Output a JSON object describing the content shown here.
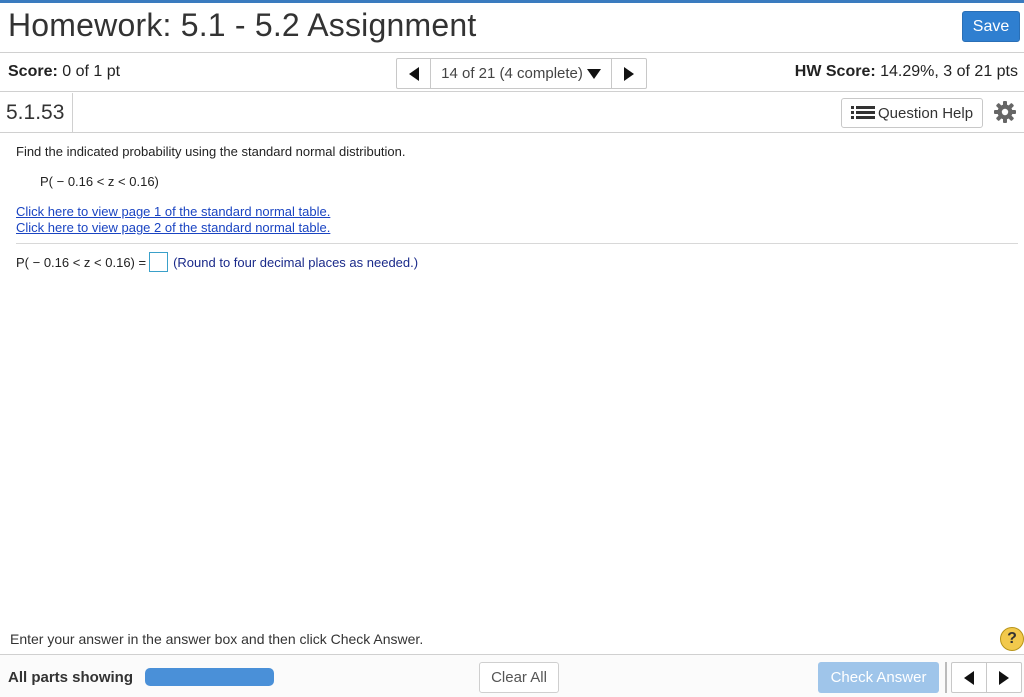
{
  "header": {
    "title": "Homework: 5.1 - 5.2 Assignment",
    "save_label": "Save",
    "accent_color": "#2f7fd0"
  },
  "score_bar": {
    "score_label": "Score:",
    "score_value": "0 of 1 pt",
    "nav_position": "14 of 21 (4 complete)",
    "hw_score_label": "HW Score:",
    "hw_score_value": "14.29%, 3 of 21 pts"
  },
  "question_bar": {
    "question_number": "5.1.53",
    "help_label": "Question Help"
  },
  "question": {
    "prompt": "Find the indicated probability using the standard normal distribution.",
    "expression": "P( − 0.16 < z < 0.16)",
    "links": [
      "Click here to view page 1 of the standard normal table.",
      "Click here to view page 2 of the standard normal table."
    ],
    "answer_prefix": "P( − 0.16 < z < 0.16) =",
    "answer_value": "",
    "answer_hint": "(Round to four decimal places as needed.)"
  },
  "footer": {
    "instruction": "Enter your answer in the answer box and then click Check Answer.",
    "help_glyph": "?",
    "parts_label": "All parts showing",
    "progress_fraction": 1.0,
    "clear_all_label": "Clear All",
    "check_answer_label": "Check Answer"
  }
}
